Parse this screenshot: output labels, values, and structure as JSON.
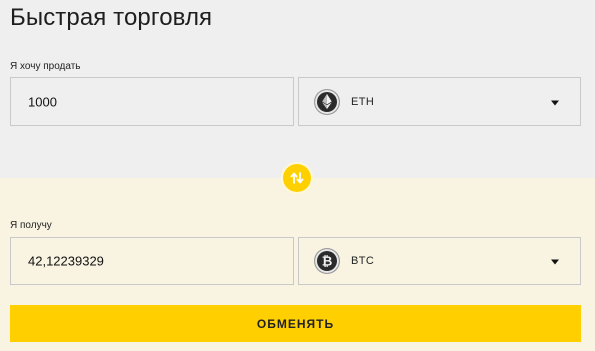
{
  "page": {
    "title": "Быстрая торговля",
    "accent_color": "#ffcf00"
  },
  "sell": {
    "label": "Я хочу продать",
    "amount": "1000",
    "currency": "ETH",
    "currency_icon": "ethereum-icon"
  },
  "swap": {
    "icon": "swap-arrows-icon"
  },
  "receive": {
    "label": "Я получу",
    "amount": "42,12239329",
    "currency": "BTC",
    "currency_icon": "bitcoin-icon"
  },
  "submit": {
    "label": "ОБМЕНЯТЬ"
  }
}
